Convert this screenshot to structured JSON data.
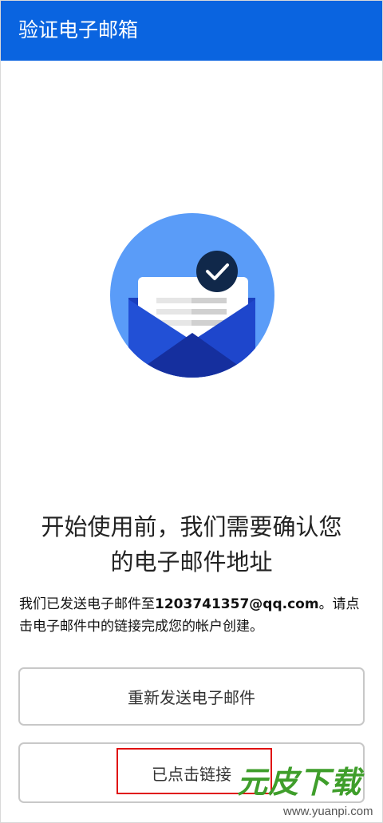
{
  "header": {
    "title": "验证电子邮箱"
  },
  "illustration": {
    "icon": "mail-verified-icon",
    "colors": {
      "circle": "#5a9cf8",
      "envelope": "#1e46cc",
      "envelope_dark": "#152f9e",
      "paper": "#ffffff",
      "badge": "#10284a",
      "check": "#ffffff"
    }
  },
  "main": {
    "headline_line1": "开始使用前，我们需要确认您",
    "headline_line2": "的电子邮件地址",
    "body_prefix": "我们已发送电子邮件至",
    "email": "1203741357@qq.com",
    "body_suffix": "。请点击电子邮件中的链接完成您的帐户创建。"
  },
  "buttons": {
    "resend_label": "重新发送电子邮件",
    "clicked_label": "已点击链接"
  },
  "watermark": {
    "text": "元皮下载",
    "url": "www.yuanpi.com"
  },
  "colors": {
    "app_bar": "#0a64e0",
    "highlight": "#e01010"
  }
}
